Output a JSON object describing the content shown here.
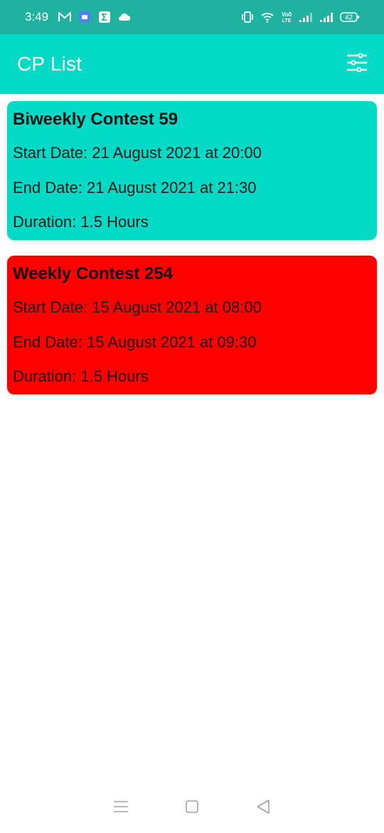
{
  "status_bar": {
    "time": "3:49",
    "battery": "42",
    "network_label": "Vo0 LTE"
  },
  "app_bar": {
    "title": "CP List",
    "filter_icon": "filter-sliders-icon"
  },
  "contests": [
    {
      "name": "Biweekly Contest 59",
      "start": "Start Date: 21 August 2021 at 20:00",
      "end": "End Date: 21 August 2021 at 21:30",
      "duration": "Duration: 1.5 Hours",
      "color": "#03dac5"
    },
    {
      "name": "Weekly Contest 254",
      "start": "Start Date: 15 August 2021 at 08:00",
      "end": "End Date: 15 August 2021 at 09:30",
      "duration": "Duration: 1.5 Hours",
      "color": "#ff0000"
    }
  ],
  "colors": {
    "status_bar": "#20b29e",
    "app_bar": "#03dac5",
    "title_text": "#ffffff"
  }
}
